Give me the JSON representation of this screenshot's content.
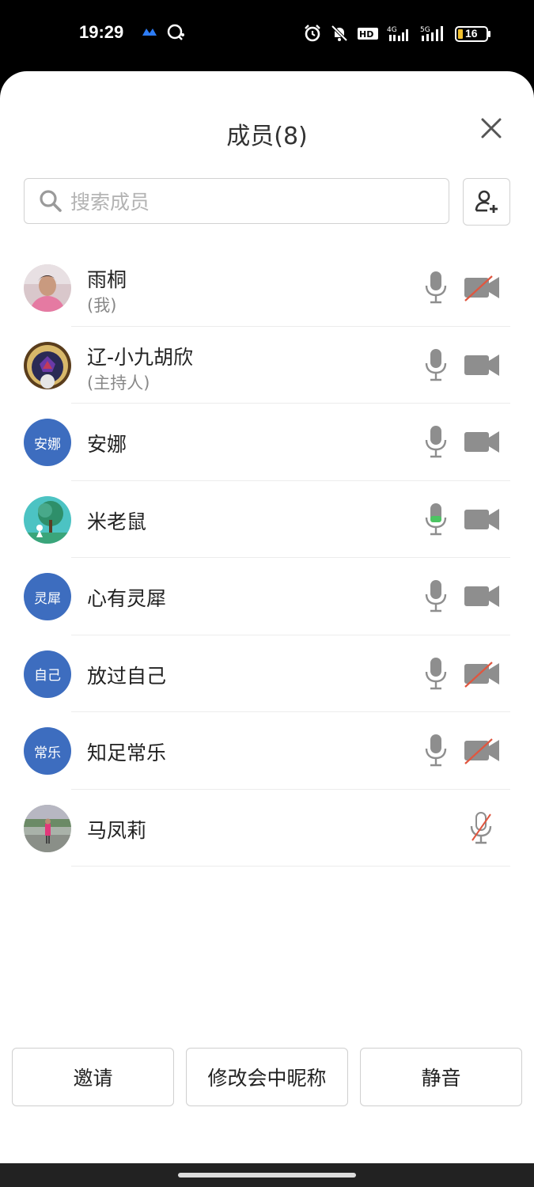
{
  "status_bar": {
    "time": "19:29",
    "battery": "16"
  },
  "header": {
    "title": "成员(8)"
  },
  "search": {
    "placeholder": "搜索成员",
    "value": ""
  },
  "members": [
    {
      "name": "雨桐",
      "tag": "(我)",
      "avatar_text": "",
      "avatar": "photo-woman",
      "mic": "on",
      "camera": "off"
    },
    {
      "name": "辽-小九胡欣",
      "tag": "(主持人)",
      "avatar_text": "",
      "avatar": "photo-flower",
      "mic": "on",
      "camera": "on"
    },
    {
      "name": "安娜",
      "tag": "",
      "avatar_text": "安娜",
      "avatar": "initials",
      "mic": "on",
      "camera": "on"
    },
    {
      "name": "米老鼠",
      "tag": "",
      "avatar_text": "",
      "avatar": "photo-tree",
      "mic": "speaking",
      "camera": "on"
    },
    {
      "name": "心有灵犀",
      "tag": "",
      "avatar_text": "灵犀",
      "avatar": "initials",
      "mic": "on",
      "camera": "on"
    },
    {
      "name": "放过自己",
      "tag": "",
      "avatar_text": "自己",
      "avatar": "initials",
      "mic": "on",
      "camera": "off"
    },
    {
      "name": "知足常乐",
      "tag": "",
      "avatar_text": "常乐",
      "avatar": "initials",
      "mic": "on",
      "camera": "off"
    },
    {
      "name": "马凤莉",
      "tag": "",
      "avatar_text": "",
      "avatar": "photo-outdoor",
      "mic": "off",
      "camera": "none"
    }
  ],
  "buttons": {
    "invite": "邀请",
    "rename": "修改会中昵称",
    "mute": "静音"
  },
  "colors": {
    "avatar_blue": "#3d6dbf",
    "icon_gray": "#8e8e8e",
    "off_red": "#e0563f",
    "speaking_green": "#4cc462"
  }
}
